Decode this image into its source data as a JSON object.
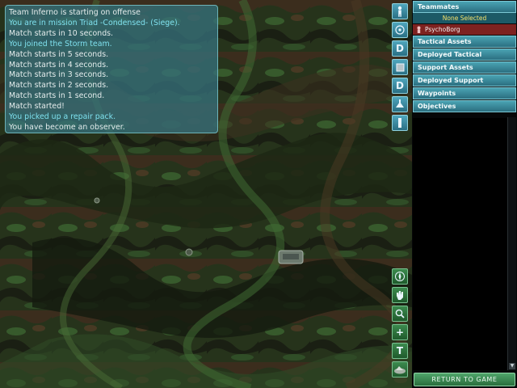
{
  "chat": {
    "lines": [
      {
        "text": "Team Inferno is starting on offense",
        "kind": "sys"
      },
      {
        "text": "You are in mission Triad -Condensed- (Siege).",
        "kind": "evt"
      },
      {
        "text": "Match starts in 10 seconds.",
        "kind": "sys"
      },
      {
        "text": "You joined the Storm team.",
        "kind": "evt"
      },
      {
        "text": "Match starts in 5 seconds.",
        "kind": "sys"
      },
      {
        "text": "Match starts in 4 seconds.",
        "kind": "sys"
      },
      {
        "text": "Match starts in 3 seconds.",
        "kind": "sys"
      },
      {
        "text": "Match starts in 2 seconds.",
        "kind": "sys"
      },
      {
        "text": "Match starts in 1 second.",
        "kind": "sys"
      },
      {
        "text": "Match started!",
        "kind": "sys"
      },
      {
        "text": "You picked up a repair pack.",
        "kind": "evt"
      },
      {
        "text": "You have become an observer.",
        "kind": "sys"
      }
    ]
  },
  "toolbar_top": {
    "buttons": [
      {
        "name": "player-icon",
        "glyph": ""
      },
      {
        "name": "target-icon",
        "glyph": ""
      },
      {
        "name": "deployable-d-icon",
        "glyph": "D"
      },
      {
        "name": "cube-icon",
        "glyph": ""
      },
      {
        "name": "deployable-d2-icon",
        "glyph": "D"
      },
      {
        "name": "turret-icon",
        "glyph": ""
      },
      {
        "name": "beacon-icon",
        "glyph": ""
      }
    ]
  },
  "toolbar_bottom": {
    "buttons": [
      {
        "name": "compass-icon",
        "glyph": ""
      },
      {
        "name": "hand-icon",
        "glyph": ""
      },
      {
        "name": "zoom-icon",
        "glyph": ""
      },
      {
        "name": "center-icon",
        "glyph": "+"
      },
      {
        "name": "text-icon",
        "glyph": "T"
      },
      {
        "name": "terrain-icon",
        "glyph": ""
      }
    ]
  },
  "sidebar": {
    "teammates_header": "Teammates",
    "selection": "None Selected",
    "teammates": [
      {
        "name": "PsychoBorg"
      }
    ],
    "sections": [
      "Tactical Assets",
      "Deployed Tactical",
      "Support Assets",
      "Deployed Support",
      "Waypoints",
      "Objectives"
    ]
  },
  "return_button": "RETURN TO GAME",
  "colors": {
    "chat_team": "#7fe0ee",
    "chat_system": "#e4ecec",
    "selection_text": "#f4e06a",
    "teammate_row": "#7d2220",
    "panel_header": "#3a8d9c",
    "return_button": "#3a8a52"
  }
}
